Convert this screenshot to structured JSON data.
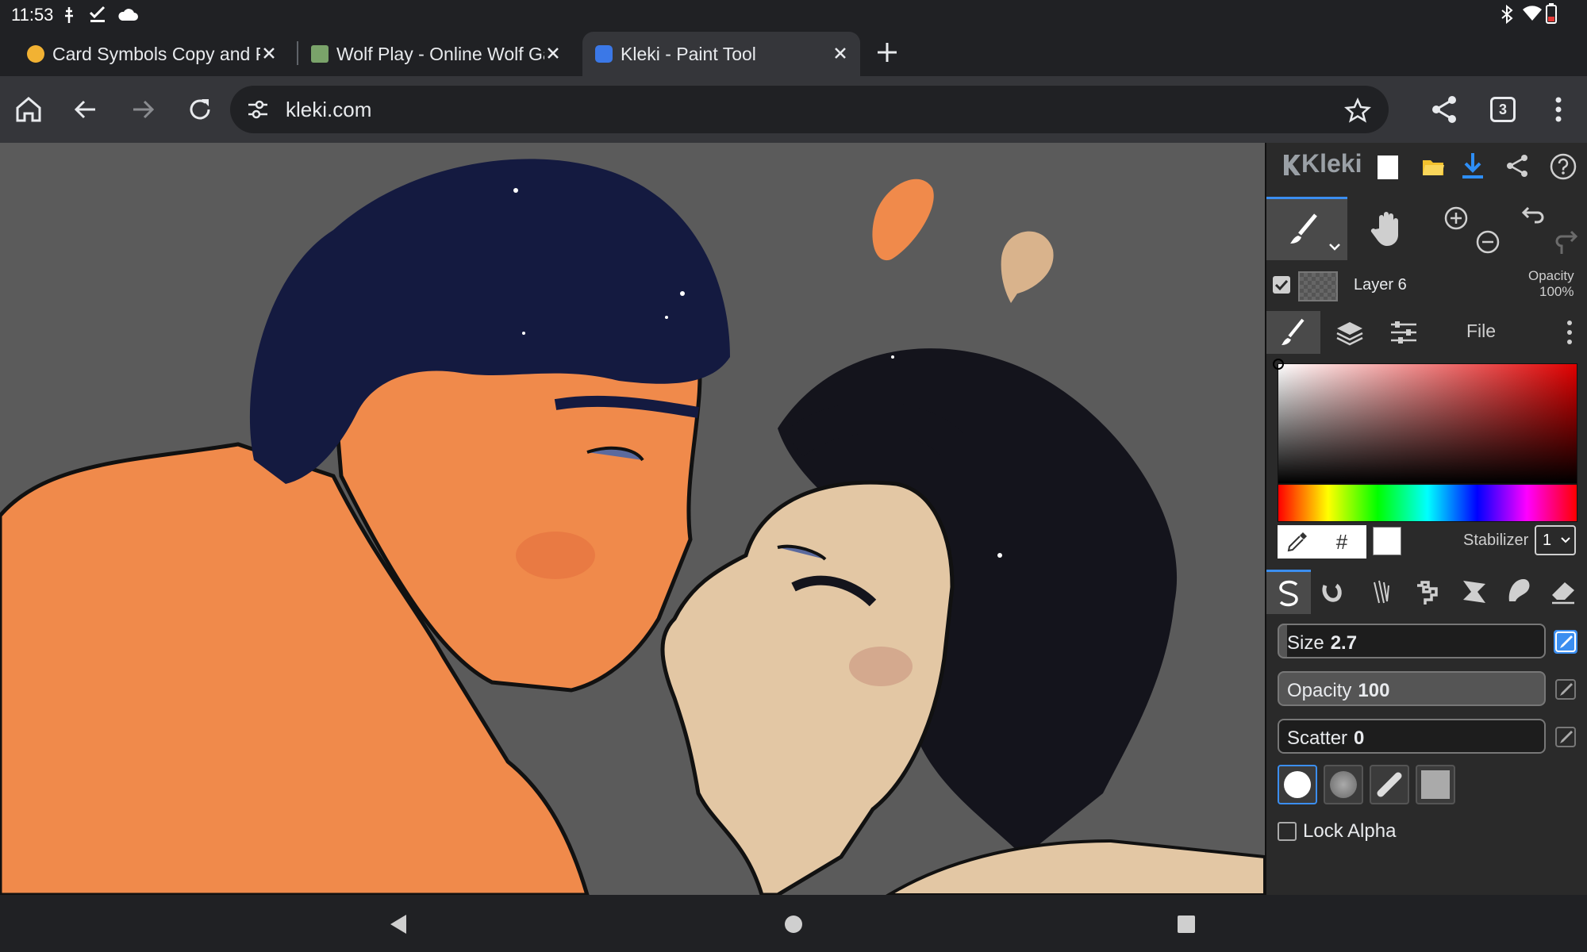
{
  "status": {
    "time": "11:53"
  },
  "tabs": [
    {
      "title": "Card Symbols Copy and Pa",
      "favicon_color": "#f2b233"
    },
    {
      "title": "Wolf Play - Online Wolf Gar",
      "favicon_color": "#7aa36a"
    },
    {
      "title": "Kleki - Paint Tool",
      "favicon_color": "#3b78e7"
    }
  ],
  "toolbar": {
    "url": "kleki.com",
    "tab_count": "3"
  },
  "kleki": {
    "logo": "Kleki",
    "layer_name": "Layer 6",
    "opacity_label": "Opacity",
    "opacity_value": "100%",
    "file_label": "File",
    "hash_label": "#",
    "stabilizer_label": "Stabilizer",
    "stabilizer_value": "1",
    "size_label": "Size",
    "size_value": "2.7",
    "brush_opacity_label": "Opacity",
    "brush_opacity_value": "100",
    "scatter_label": "Scatter",
    "scatter_value": "0",
    "lock_alpha_label": "Lock Alpha",
    "accent": "#3b8ef0",
    "download_color": "#2e8ef5",
    "folder_color": "#f2c12e"
  },
  "canvas": {
    "background": "#5b5b5b",
    "skin_left": "#f08a4b",
    "skin_right": "#e3c7a4",
    "hair_left": "#141a40",
    "hair_right": "#14141c",
    "swatch_1": "#f08a4b",
    "swatch_2": "#d9b38c"
  }
}
